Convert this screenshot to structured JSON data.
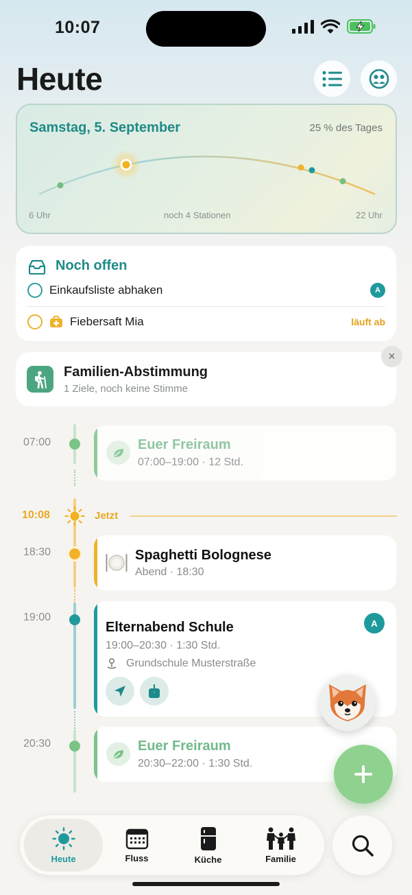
{
  "status": {
    "time": "10:07"
  },
  "header": {
    "title": "Heute",
    "list_icon": "list-icon",
    "family_icon": "family-face-icon"
  },
  "day": {
    "date": "Samstag, 5. September",
    "progress": "25 % des Tages",
    "progress_value": 0.25,
    "start_label": "6 Uhr",
    "middle_label": "noch 4 Stationen",
    "end_label": "22 Uhr"
  },
  "open_tasks": {
    "title": "Noch offen",
    "items": [
      {
        "label": "Einkaufsliste abhaken",
        "assignee": "A",
        "status": ""
      },
      {
        "label": "Fiebersaft Mia",
        "assignee": "",
        "status": "läuft ab"
      }
    ]
  },
  "vote": {
    "title": "Familien-Abstimmung",
    "subtitle": "1 Ziele, noch keine Stimme",
    "close": "×"
  },
  "now": {
    "time": "10:08",
    "label": "Jetzt"
  },
  "timeline": [
    {
      "time": "07:00",
      "title": "Euer Freiraum",
      "subtitle": "07:00–19:00 · 12 Std."
    },
    {
      "time": "18:30",
      "title": "Spaghetti Bolognese",
      "subtitle": "Abend · 18:30"
    },
    {
      "time": "19:00",
      "title": "Elternabend Schule",
      "subtitle": "19:00–20:30 · 1:30 Std.",
      "location": "Grundschule Musterstraße",
      "assignee": "A"
    },
    {
      "time": "20:30",
      "title": "Euer Freiraum",
      "subtitle": "20:30–22:00 · 1:30 Std."
    }
  ],
  "tabs": [
    {
      "label": "Heute",
      "icon": "sun-icon",
      "active": true
    },
    {
      "label": "Fluss",
      "icon": "calendar-icon",
      "active": false
    },
    {
      "label": "Küche",
      "icon": "fridge-icon",
      "active": false
    },
    {
      "label": "Familie",
      "icon": "family-icon",
      "active": false
    }
  ],
  "colors": {
    "accent": "#1f9a9c",
    "free": "#72b98b",
    "now": "#eaa822",
    "meal": "#f0b22a",
    "event": "#1f9a9c"
  }
}
